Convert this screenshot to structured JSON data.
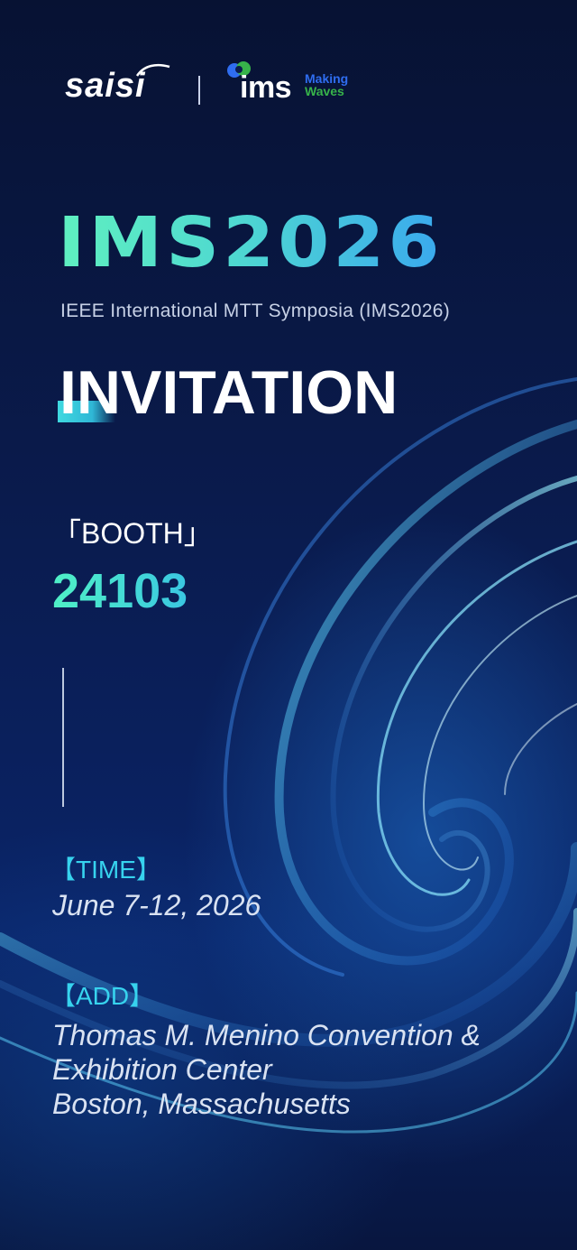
{
  "header": {
    "saisi_logo": "saisi",
    "ims_logo": "ims",
    "ims_tagline_line1": "Making",
    "ims_tagline_line2": "Waves"
  },
  "event": {
    "title": "IMS2026",
    "subtitle": "IEEE International MTT Symposia (IMS2026)",
    "heading": "INVITATION"
  },
  "booth": {
    "label": "「BOOTH」",
    "number": "24103"
  },
  "time": {
    "label": "【TIME】",
    "value": "June 7-12, 2026"
  },
  "address": {
    "label": "【ADD】",
    "lines": [
      "Thomas M. Menino Convention &",
      "Exhibition Center",
      "Boston, Massachusetts"
    ]
  },
  "colors": {
    "background": "#08163f",
    "accent_cyan": "#37d3ee",
    "accent_green": "#5ff0c0",
    "ims_blue": "#2f6df0",
    "ims_green": "#37b34a"
  }
}
